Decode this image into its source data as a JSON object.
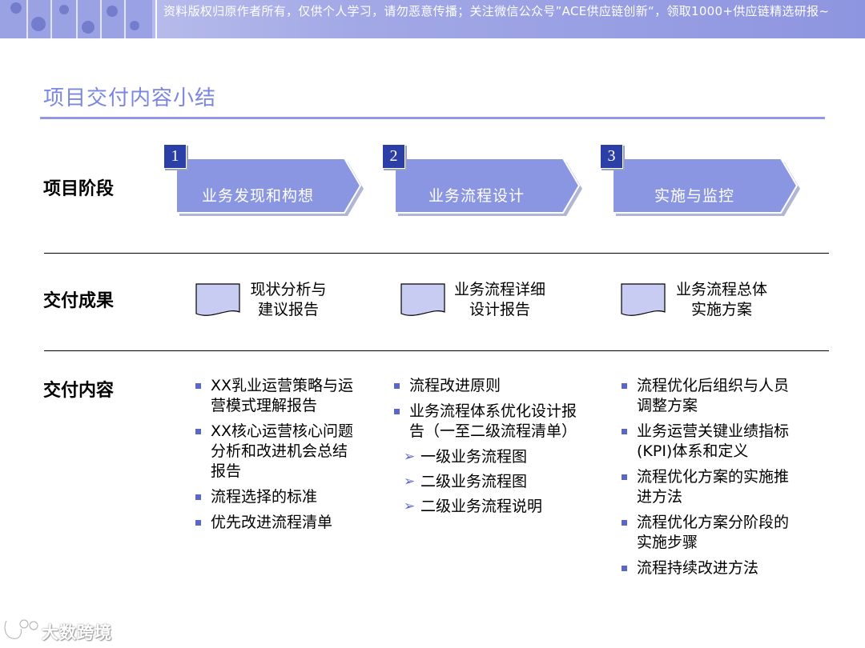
{
  "banner": {
    "text": "资料版权归原作者所有，仅供个人学习，请勿恶意传播；关注微信公众号”ACE供应链创新“，领取1000+供应链精选研报~"
  },
  "title": "项目交付内容小结",
  "rows": {
    "phase_label": "项目阶段",
    "deliverable_label": "交付成果",
    "content_label": "交付内容"
  },
  "phases": [
    {
      "number": "1",
      "label": "业务发现和构想"
    },
    {
      "number": "2",
      "label": "业务流程设计"
    },
    {
      "number": "3",
      "label": "实施与监控"
    }
  ],
  "deliverables": [
    {
      "line1": "现状分析与",
      "line2": "建议报告"
    },
    {
      "line1": "业务流程详细",
      "line2": "设计报告"
    },
    {
      "line1": "业务流程总体",
      "line2": "实施方案"
    }
  ],
  "contents": [
    {
      "items": [
        {
          "text": "XX乳业运营策略与运营模式理解报告",
          "sub": []
        },
        {
          "text": "XX核心运营核心问题分析和改进机会总结报告",
          "sub": []
        },
        {
          "text": "流程选择的标准",
          "sub": []
        },
        {
          "text": "优先改进流程清单",
          "sub": []
        }
      ]
    },
    {
      "items": [
        {
          "text": "流程改进原则",
          "sub": []
        },
        {
          "text": "业务流程体系优化设计报告（一至二级流程清单）",
          "sub": [
            "一级业务流程图",
            "二级业务流程图",
            "二级业务流程说明"
          ]
        }
      ]
    },
    {
      "items": [
        {
          "text": "流程优化后组织与人员调整方案",
          "sub": []
        },
        {
          "text": "业务运营关键业绩指标(KPI)体系和定义",
          "sub": []
        },
        {
          "text": "流程优化方案的实施推进方法",
          "sub": []
        },
        {
          "text": "流程优化方案分阶段的实施步骤",
          "sub": []
        },
        {
          "text": "流程持续改进方法",
          "sub": []
        }
      ]
    }
  ],
  "watermark": {
    "text": "大数跨境",
    "icon": "logo-icon"
  },
  "colors": {
    "accent": "#7b86e0",
    "phase_fill": "#8a96e2",
    "badge": "#2c3fa6",
    "doc_fill": "#c8ccf2",
    "bullet": "#5b67c8"
  }
}
